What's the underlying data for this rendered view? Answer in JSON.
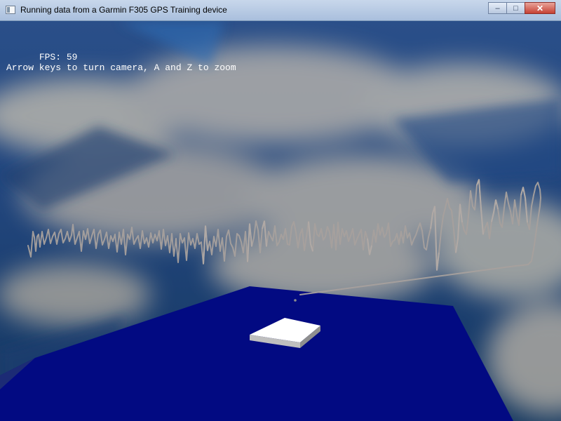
{
  "window": {
    "title": "Running data from a Garmin F305 GPS Training device",
    "icon": "app-window-icon"
  },
  "controls": {
    "minimize_glyph": "–",
    "maximize_glyph": "□",
    "close_glyph": "✕"
  },
  "hud": {
    "fps_label": "FPS: ",
    "fps_value": "59",
    "instructions": "Arrow keys to turn camera, A and Z to zoom"
  },
  "colors": {
    "sky_base": "#27558f",
    "cloud": "#c4b9a6",
    "ground_plane": "#020a82",
    "marker_top": "#ffffff",
    "marker_side": "#9a9a9a",
    "track_line": "#a9a09d",
    "floor_highlight": "#4f94f3"
  }
}
